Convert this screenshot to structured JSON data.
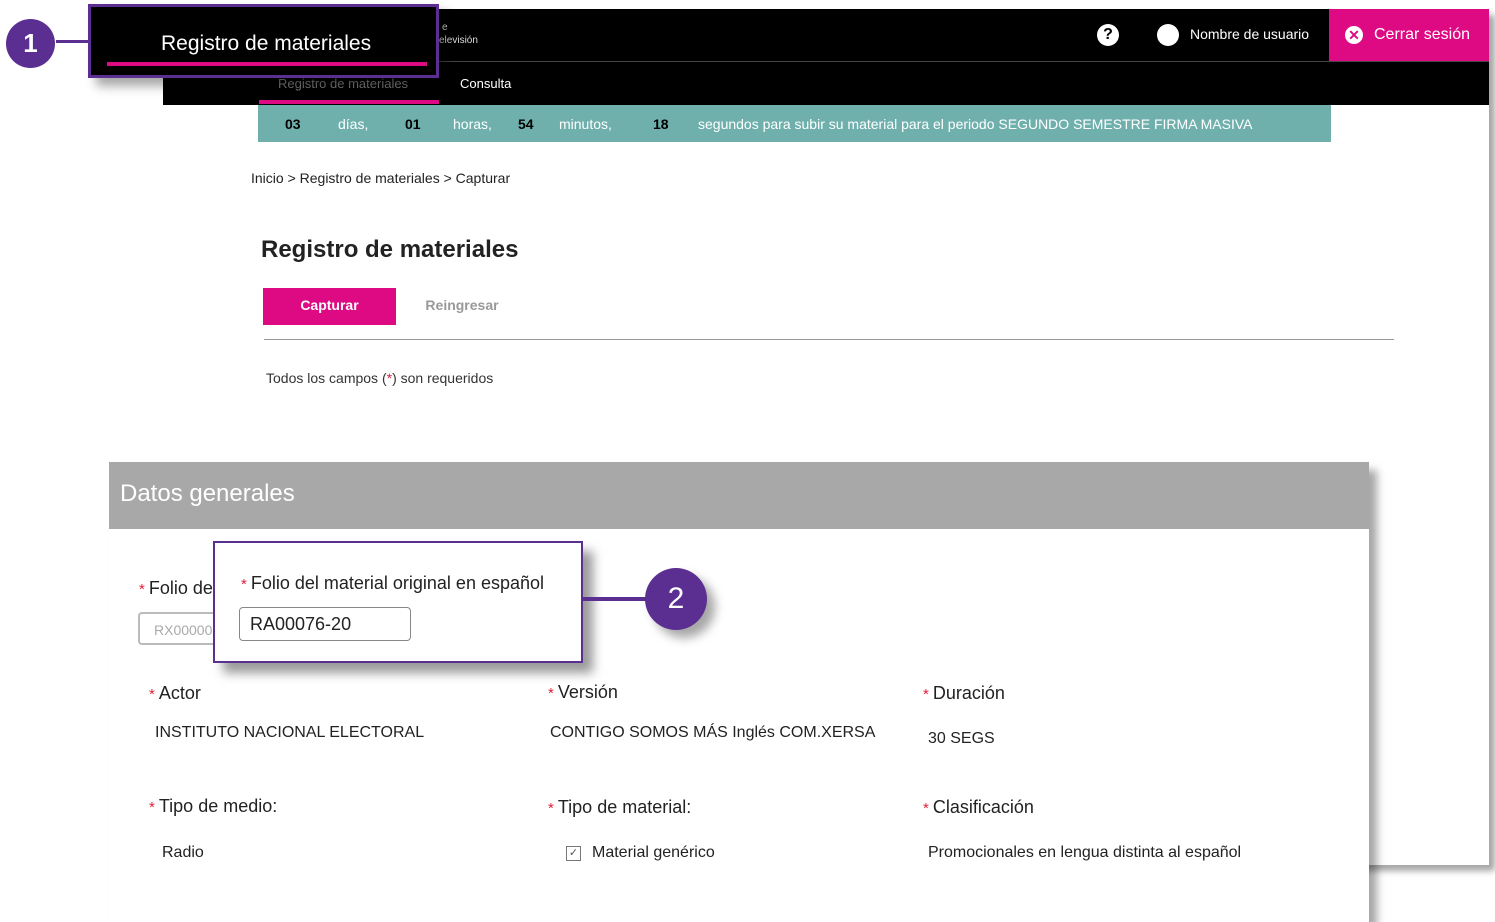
{
  "header": {
    "brand_fragment_1": "e",
    "brand_fragment_2": "elevisión",
    "help_icon": "?",
    "user_name": "Nombre de usuario",
    "logout_label": "Cerrar sesión",
    "logout_icon": "✕"
  },
  "nav": {
    "tabs": [
      {
        "label": "Registro de materiales",
        "active": true
      },
      {
        "label": "Consulta",
        "active": false
      }
    ]
  },
  "timer": {
    "days": "03",
    "days_label": "días,",
    "hours": "01",
    "hours_label": "horas,",
    "minutes": "54",
    "minutes_label": "minutos,",
    "seconds": "18",
    "message": "segundos para subir su material para el periodo SEGUNDO SEMESTRE  FIRMA MASIVA"
  },
  "breadcrumb": "Inicio > Registro de materiales >  Capturar",
  "page_title": "Registro de materiales",
  "tabs": {
    "capturar": "Capturar",
    "reingresar": "Reingresar"
  },
  "required_note": {
    "before": "Todos los campos (",
    "star": "*",
    "after": ") son requeridos"
  },
  "datos_generales": {
    "title": "Datos generales",
    "folio_label_partial": "Folio de",
    "folio_placeholder_partial": "RX00000",
    "actor": {
      "label": "Actor",
      "value": "INSTITUTO NACIONAL ELECTORAL"
    },
    "version": {
      "label": "Versión",
      "value": "CONTIGO SOMOS MÁS Inglés COM.XERSA"
    },
    "duracion": {
      "label": "Duración",
      "value": "30 SEGS"
    },
    "tipo_medio": {
      "label": "Tipo de medio:",
      "value": "Radio"
    },
    "tipo_material": {
      "label": "Tipo de material:",
      "value": "Material genérico",
      "checked": true
    },
    "clasificacion": {
      "label": "Clasificación",
      "value": "Promocionales en lengua distinta al español"
    }
  },
  "callouts": {
    "one": {
      "number": "1",
      "text": "Registro de materiales"
    },
    "two": {
      "number": "2",
      "label": "Folio del material original en español",
      "value": "RA00076-20"
    }
  },
  "colors": {
    "accent": "#dd0a83",
    "callout": "#5b2f91",
    "timer": "#6fb0ad",
    "section_header": "#a8a8a8"
  }
}
